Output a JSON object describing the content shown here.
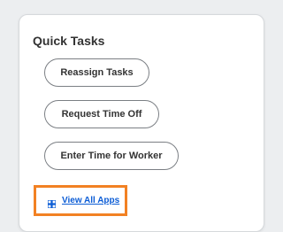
{
  "quick_tasks": {
    "title": "Quick Tasks",
    "buttons": [
      {
        "label": "Reassign Tasks"
      },
      {
        "label": "Request Time Off"
      },
      {
        "label": "Enter Time for Worker"
      }
    ],
    "view_all": {
      "label": "View All Apps",
      "icon": "grid-icon",
      "link_color": "#0b5cd5",
      "highlight_color": "#f28123"
    }
  }
}
